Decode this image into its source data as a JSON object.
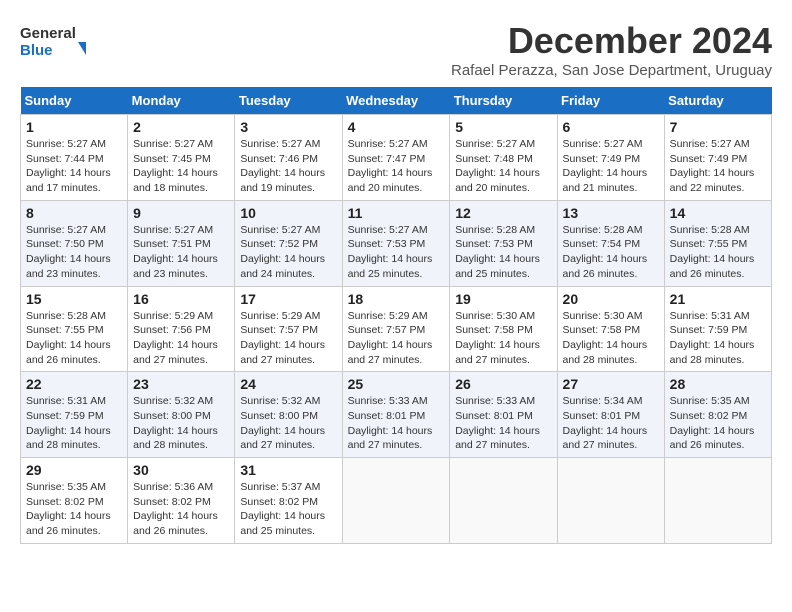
{
  "logo": {
    "line1": "General",
    "line2": "Blue"
  },
  "title": "December 2024",
  "subtitle": "Rafael Perazza, San Jose Department, Uruguay",
  "days_of_week": [
    "Sunday",
    "Monday",
    "Tuesday",
    "Wednesday",
    "Thursday",
    "Friday",
    "Saturday"
  ],
  "weeks": [
    [
      {
        "day": 1,
        "info": "Sunrise: 5:27 AM\nSunset: 7:44 PM\nDaylight: 14 hours\nand 17 minutes."
      },
      {
        "day": 2,
        "info": "Sunrise: 5:27 AM\nSunset: 7:45 PM\nDaylight: 14 hours\nand 18 minutes."
      },
      {
        "day": 3,
        "info": "Sunrise: 5:27 AM\nSunset: 7:46 PM\nDaylight: 14 hours\nand 19 minutes."
      },
      {
        "day": 4,
        "info": "Sunrise: 5:27 AM\nSunset: 7:47 PM\nDaylight: 14 hours\nand 20 minutes."
      },
      {
        "day": 5,
        "info": "Sunrise: 5:27 AM\nSunset: 7:48 PM\nDaylight: 14 hours\nand 20 minutes."
      },
      {
        "day": 6,
        "info": "Sunrise: 5:27 AM\nSunset: 7:49 PM\nDaylight: 14 hours\nand 21 minutes."
      },
      {
        "day": 7,
        "info": "Sunrise: 5:27 AM\nSunset: 7:49 PM\nDaylight: 14 hours\nand 22 minutes."
      }
    ],
    [
      {
        "day": 8,
        "info": "Sunrise: 5:27 AM\nSunset: 7:50 PM\nDaylight: 14 hours\nand 23 minutes."
      },
      {
        "day": 9,
        "info": "Sunrise: 5:27 AM\nSunset: 7:51 PM\nDaylight: 14 hours\nand 23 minutes."
      },
      {
        "day": 10,
        "info": "Sunrise: 5:27 AM\nSunset: 7:52 PM\nDaylight: 14 hours\nand 24 minutes."
      },
      {
        "day": 11,
        "info": "Sunrise: 5:27 AM\nSunset: 7:53 PM\nDaylight: 14 hours\nand 25 minutes."
      },
      {
        "day": 12,
        "info": "Sunrise: 5:28 AM\nSunset: 7:53 PM\nDaylight: 14 hours\nand 25 minutes."
      },
      {
        "day": 13,
        "info": "Sunrise: 5:28 AM\nSunset: 7:54 PM\nDaylight: 14 hours\nand 26 minutes."
      },
      {
        "day": 14,
        "info": "Sunrise: 5:28 AM\nSunset: 7:55 PM\nDaylight: 14 hours\nand 26 minutes."
      }
    ],
    [
      {
        "day": 15,
        "info": "Sunrise: 5:28 AM\nSunset: 7:55 PM\nDaylight: 14 hours\nand 26 minutes."
      },
      {
        "day": 16,
        "info": "Sunrise: 5:29 AM\nSunset: 7:56 PM\nDaylight: 14 hours\nand 27 minutes."
      },
      {
        "day": 17,
        "info": "Sunrise: 5:29 AM\nSunset: 7:57 PM\nDaylight: 14 hours\nand 27 minutes."
      },
      {
        "day": 18,
        "info": "Sunrise: 5:29 AM\nSunset: 7:57 PM\nDaylight: 14 hours\nand 27 minutes."
      },
      {
        "day": 19,
        "info": "Sunrise: 5:30 AM\nSunset: 7:58 PM\nDaylight: 14 hours\nand 27 minutes."
      },
      {
        "day": 20,
        "info": "Sunrise: 5:30 AM\nSunset: 7:58 PM\nDaylight: 14 hours\nand 28 minutes."
      },
      {
        "day": 21,
        "info": "Sunrise: 5:31 AM\nSunset: 7:59 PM\nDaylight: 14 hours\nand 28 minutes."
      }
    ],
    [
      {
        "day": 22,
        "info": "Sunrise: 5:31 AM\nSunset: 7:59 PM\nDaylight: 14 hours\nand 28 minutes."
      },
      {
        "day": 23,
        "info": "Sunrise: 5:32 AM\nSunset: 8:00 PM\nDaylight: 14 hours\nand 28 minutes."
      },
      {
        "day": 24,
        "info": "Sunrise: 5:32 AM\nSunset: 8:00 PM\nDaylight: 14 hours\nand 27 minutes."
      },
      {
        "day": 25,
        "info": "Sunrise: 5:33 AM\nSunset: 8:01 PM\nDaylight: 14 hours\nand 27 minutes."
      },
      {
        "day": 26,
        "info": "Sunrise: 5:33 AM\nSunset: 8:01 PM\nDaylight: 14 hours\nand 27 minutes."
      },
      {
        "day": 27,
        "info": "Sunrise: 5:34 AM\nSunset: 8:01 PM\nDaylight: 14 hours\nand 27 minutes."
      },
      {
        "day": 28,
        "info": "Sunrise: 5:35 AM\nSunset: 8:02 PM\nDaylight: 14 hours\nand 26 minutes."
      }
    ],
    [
      {
        "day": 29,
        "info": "Sunrise: 5:35 AM\nSunset: 8:02 PM\nDaylight: 14 hours\nand 26 minutes."
      },
      {
        "day": 30,
        "info": "Sunrise: 5:36 AM\nSunset: 8:02 PM\nDaylight: 14 hours\nand 26 minutes."
      },
      {
        "day": 31,
        "info": "Sunrise: 5:37 AM\nSunset: 8:02 PM\nDaylight: 14 hours\nand 25 minutes."
      },
      null,
      null,
      null,
      null
    ]
  ]
}
